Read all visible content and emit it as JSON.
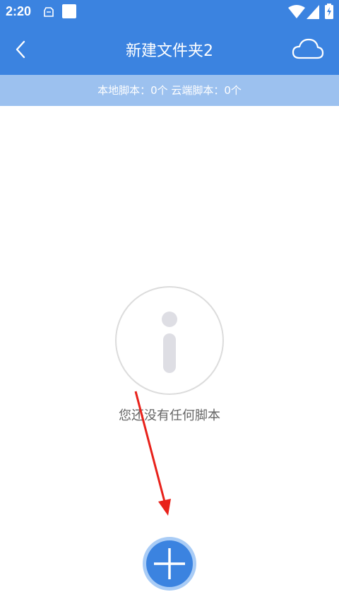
{
  "status_bar": {
    "time": "2:20",
    "icons": [
      "notification-icon",
      "app-square-icon",
      "wifi-icon",
      "signal-icon",
      "battery-charging-icon"
    ]
  },
  "header": {
    "title": "新建文件夹2",
    "back_icon": "chevron-left-icon",
    "cloud_icon": "cloud-icon"
  },
  "summary": {
    "text": "本地脚本：0个 云端脚本：0个"
  },
  "empty_state": {
    "icon": "info-icon",
    "message": "您还没有任何脚本"
  },
  "fab": {
    "icon": "plus-icon"
  },
  "colors": {
    "primary": "#3b83e0",
    "summary_bar": "#9cc1ef",
    "fab_ring": "#a9ccf6",
    "arrow": "#e8211a",
    "info_gray": "#dedee4"
  }
}
